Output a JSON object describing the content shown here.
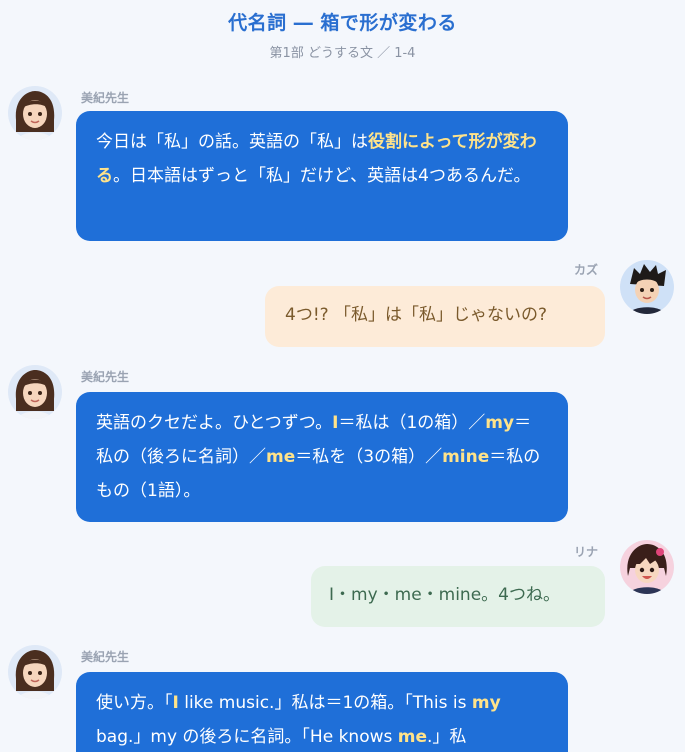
{
  "header": {
    "title": "代名詞 ― 箱で形が変わる",
    "subtitle": "第1部 どうする文 ／ 1-4"
  },
  "messages": [
    {
      "speaker": "美紀先生",
      "parts": [
        {
          "t": "今日は「私」の話。英語の「私」は"
        },
        {
          "t": "役割によって形が変わる",
          "hl": true
        },
        {
          "t": "。日本語はずっと「私」だけど、英語は4つあるんだ。"
        }
      ]
    },
    {
      "speaker": "カズ",
      "text": "4つ!? 「私」は「私」じゃないの?"
    },
    {
      "speaker": "美紀先生",
      "parts": [
        {
          "t": "英語のクセだよ。ひとつずつ。"
        },
        {
          "t": "I",
          "hl": true
        },
        {
          "t": "＝私は（1の箱）／"
        },
        {
          "t": "my",
          "hl": true
        },
        {
          "t": "＝私の（後ろに名詞）／"
        },
        {
          "t": "me",
          "hl": true
        },
        {
          "t": "＝私を（3の箱）／"
        },
        {
          "t": "mine",
          "hl": true
        },
        {
          "t": "＝私のもの（1語）。"
        }
      ]
    },
    {
      "speaker": "リナ",
      "text": "I・my・me・mine。4つね。"
    },
    {
      "speaker": "美紀先生",
      "parts": [
        {
          "t": "使い方。「"
        },
        {
          "t": "I",
          "hl": true
        },
        {
          "t": " like music.」私は＝1の箱。「This is "
        },
        {
          "t": "my",
          "hl": true
        },
        {
          "t": " bag.」my の後ろに名詞。「He knows "
        },
        {
          "t": "me",
          "hl": true
        },
        {
          "t": ".」私"
        }
      ]
    }
  ]
}
